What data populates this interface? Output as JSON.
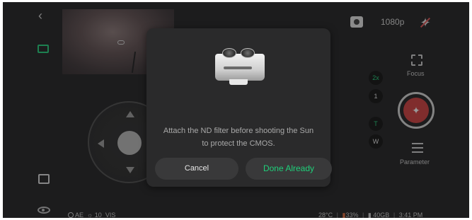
{
  "top_bar": {
    "resolution": "1080p"
  },
  "right_panel": {
    "focus_label": "Focus",
    "zoom_2x": "2x",
    "zoom_1": "1",
    "tele": "T",
    "wide": "W",
    "parameter_label": "Parameter"
  },
  "status_bar": {
    "left": {
      "mode": "AE",
      "value": "10",
      "vis": "VIS"
    },
    "right": {
      "temperature": "28°C",
      "battery": "33%",
      "storage": "40GB",
      "time": "3:41 PM"
    }
  },
  "modal": {
    "message": "Attach the ND filter before shooting the Sun to protect the CMOS.",
    "cancel_label": "Cancel",
    "confirm_label": "Done Already"
  },
  "colors": {
    "accent": "#1fd07a",
    "shutter": "#d23b3b",
    "background": "#1c1c1d",
    "modal": "#2a2a2b"
  },
  "icons": [
    "back-chevron-icon",
    "photo-mode-icon",
    "gallery-icon",
    "eye-icon",
    "camera-icon",
    "satellite-icon",
    "focus-icon",
    "parameter-icon",
    "nd-filter-image"
  ]
}
